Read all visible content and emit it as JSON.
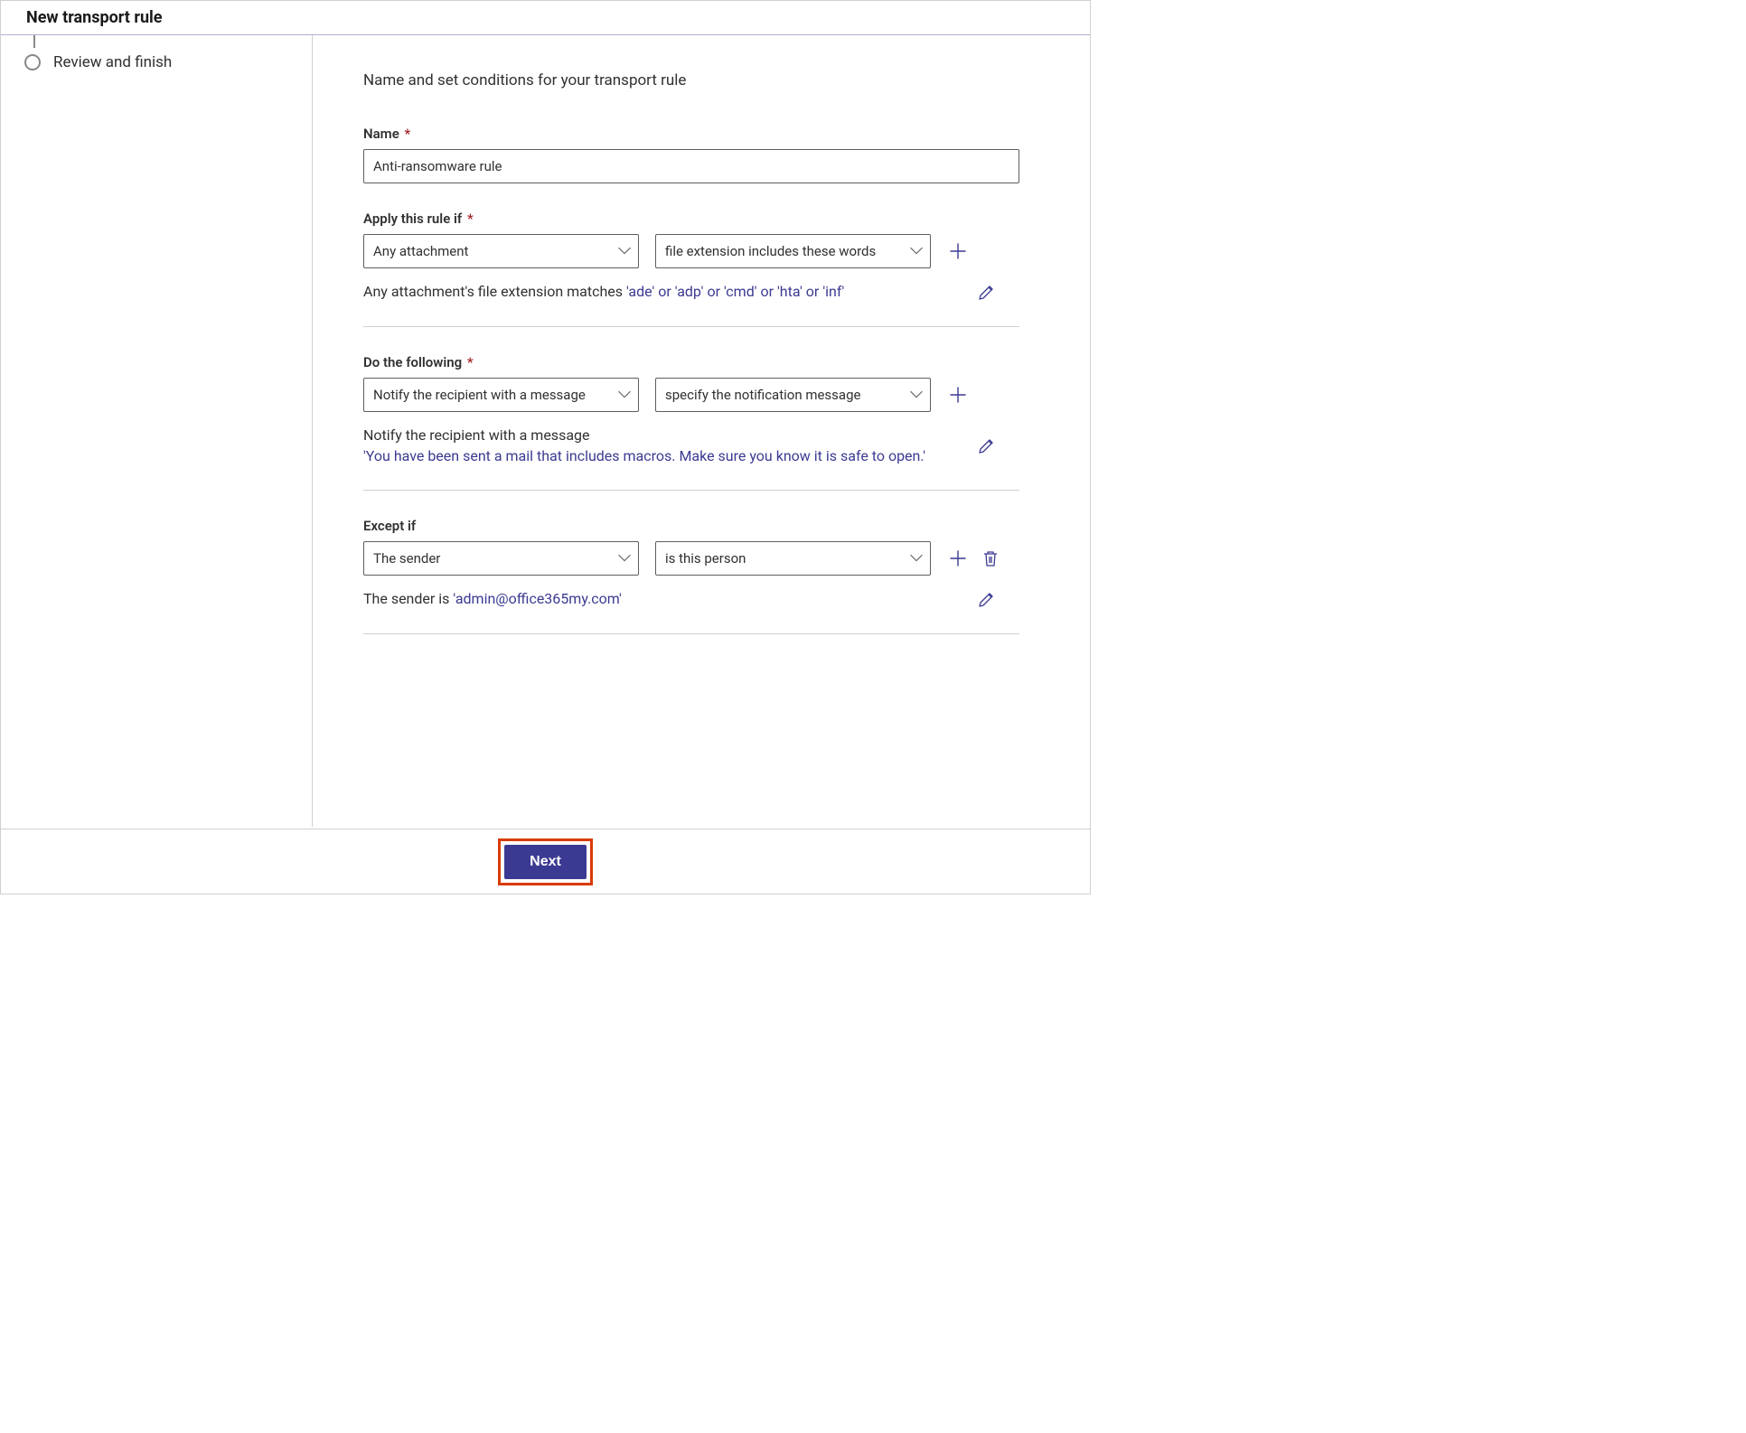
{
  "header": {
    "title": "New transport rule"
  },
  "sidebar": {
    "steps": [
      {
        "label": "Review and finish"
      }
    ]
  },
  "subtitle": "Name and set conditions for your transport rule",
  "labels": {
    "name": "Name",
    "apply_if": "Apply this rule if",
    "do_following": "Do the following",
    "except_if": "Except if"
  },
  "name_input": {
    "value": "Anti-ransomware rule",
    "placeholder": ""
  },
  "apply_if": {
    "dd1": "Any attachment",
    "dd2": "file extension includes these words",
    "summary_prefix": "Any attachment's file extension matches ",
    "summary_value": "'ade' or 'adp' or 'cmd' or 'hta' or 'inf'"
  },
  "do_following": {
    "dd1": "Notify the recipient with a message",
    "dd2": "specify the notification message",
    "summary_line1_prefix": "Notify the recipient with a message",
    "summary_line2_value": "'You have been sent a mail that includes macros. Make sure you know it is safe to open.'"
  },
  "except_if": {
    "dd1": "The sender",
    "dd2": "is this person",
    "summary_prefix": "The sender is ",
    "summary_value": "'admin@office365my.com'"
  },
  "footer": {
    "next": "Next"
  }
}
